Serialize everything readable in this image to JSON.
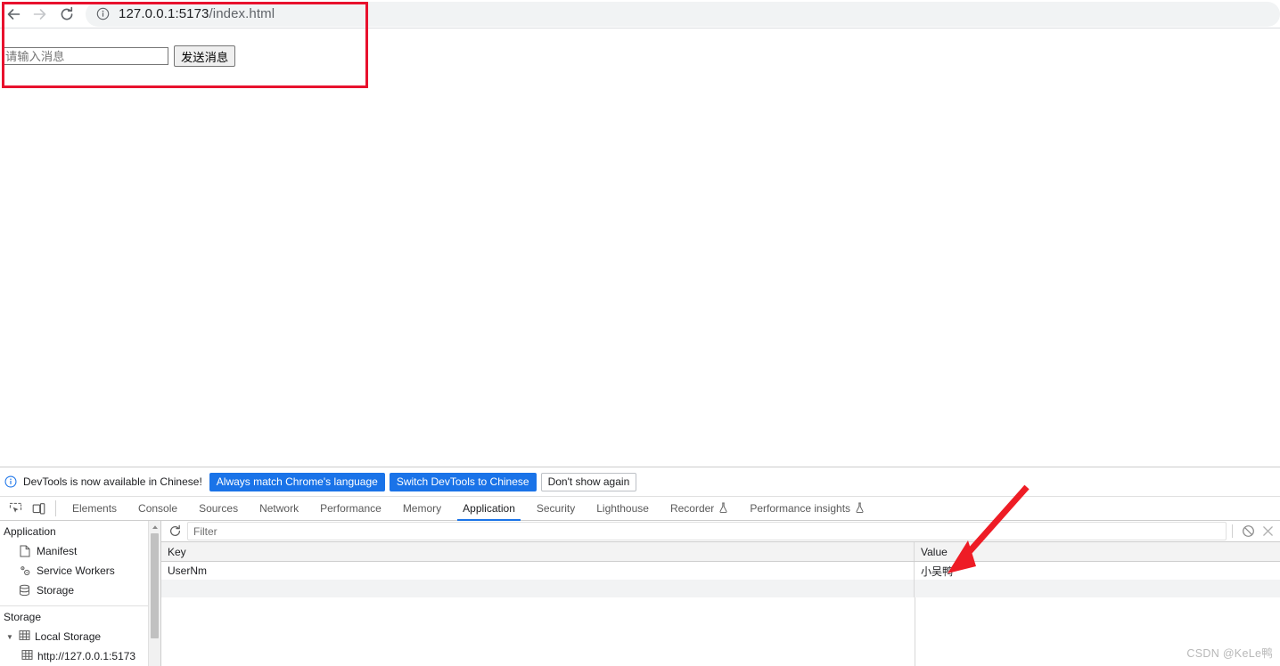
{
  "browser": {
    "back_icon": "arrow-left-icon",
    "forward_icon": "arrow-right-icon",
    "reload_icon": "reload-icon",
    "info_icon": "info-circle-icon",
    "url_host": "127.0.0.1:5173",
    "url_path": "/index.html",
    "url_full": "127.0.0.1:5173/index.html"
  },
  "page": {
    "input_placeholder": "请输入消息",
    "input_value": "",
    "send_button": "发送消息"
  },
  "devtools": {
    "notice": {
      "icon": "info-circle-icon",
      "text": "DevTools is now available in Chinese!",
      "btn_always_match": "Always match Chrome's language",
      "btn_switch": "Switch DevTools to Chinese",
      "btn_dismiss": "Don't show again"
    },
    "toolbar_icons": {
      "inspect": "inspect-element-icon",
      "device": "device-toolbar-icon"
    },
    "tabs": [
      {
        "label": "Elements",
        "active": false,
        "icon": ""
      },
      {
        "label": "Console",
        "active": false,
        "icon": ""
      },
      {
        "label": "Sources",
        "active": false,
        "icon": ""
      },
      {
        "label": "Network",
        "active": false,
        "icon": ""
      },
      {
        "label": "Performance",
        "active": false,
        "icon": ""
      },
      {
        "label": "Memory",
        "active": false,
        "icon": ""
      },
      {
        "label": "Application",
        "active": true,
        "icon": ""
      },
      {
        "label": "Security",
        "active": false,
        "icon": ""
      },
      {
        "label": "Lighthouse",
        "active": false,
        "icon": ""
      },
      {
        "label": "Recorder",
        "active": false,
        "icon": "flask-icon"
      },
      {
        "label": "Performance insights",
        "active": false,
        "icon": "flask-icon"
      }
    ],
    "sidebar": {
      "application_title": "Application",
      "application_items": [
        {
          "label": "Manifest",
          "icon": "document-icon"
        },
        {
          "label": "Service Workers",
          "icon": "gears-icon"
        },
        {
          "label": "Storage",
          "icon": "database-icon"
        }
      ],
      "storage_title": "Storage",
      "local_storage": {
        "label": "Local Storage",
        "icon": "table-icon",
        "expanded": true
      },
      "local_storage_child": {
        "label": "http://127.0.0.1:5173",
        "icon": "table-icon"
      }
    },
    "filter_bar": {
      "refresh_icon": "refresh-icon",
      "filter_placeholder": "Filter",
      "filter_value": "",
      "clear_icon": "clear-all-icon",
      "delete_icon": "delete-icon"
    },
    "storage_table": {
      "columns": [
        "Key",
        "Value"
      ],
      "rows": [
        {
          "key": "UserNm",
          "value": "小吴鸭"
        }
      ]
    }
  },
  "watermark": "CSDN @KeLe鸭",
  "colors": {
    "accent_blue": "#1a73e8",
    "annotation_red": "#e8112d"
  }
}
